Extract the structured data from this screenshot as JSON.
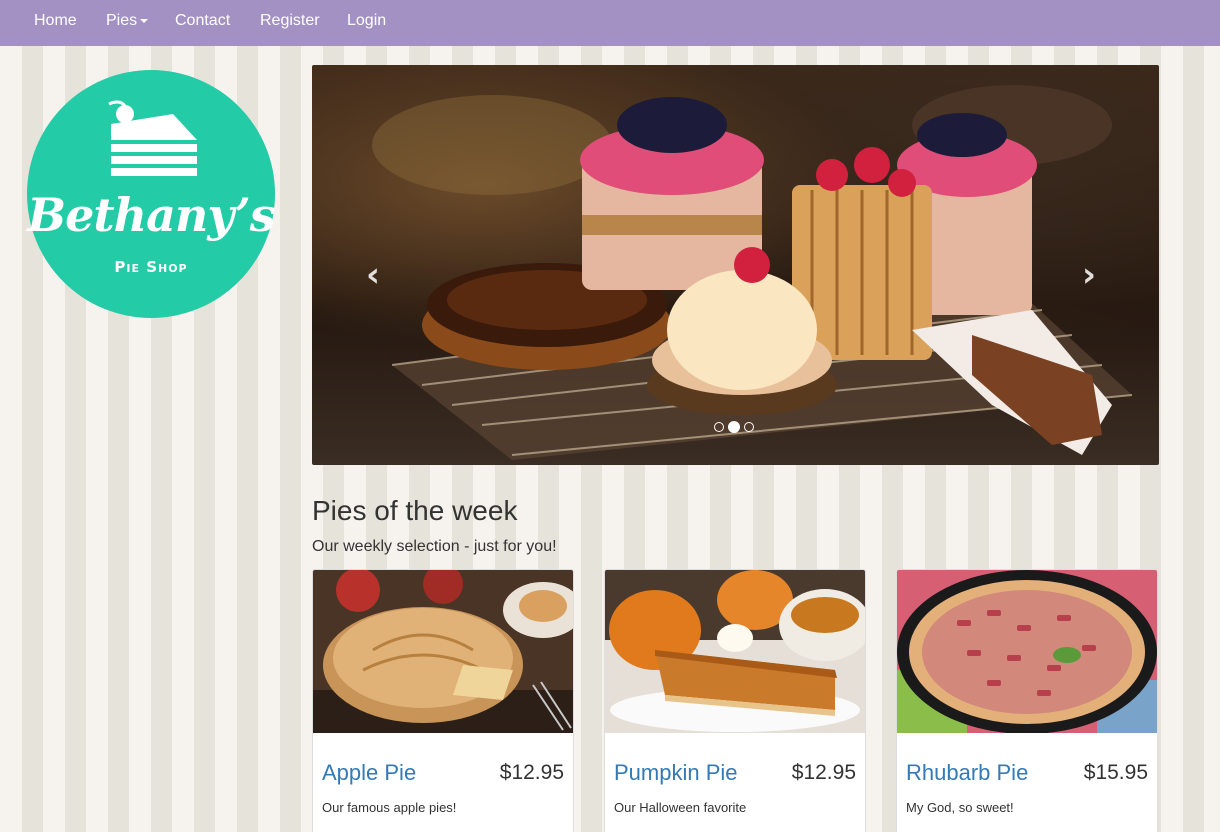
{
  "nav": {
    "items": [
      "Home",
      "Pies",
      "Contact",
      "Register",
      "Login"
    ],
    "dropdown_item": "Pies"
  },
  "logo": {
    "name": "Bethany’s",
    "subtitle": "Pie Shop",
    "color": "#23cba6"
  },
  "carousel": {
    "prev_symbol": "‹",
    "next_symbol": "›",
    "slide_count": 3,
    "active_slide": 2
  },
  "section": {
    "title": "Pies of the week",
    "subtitle": "Our weekly selection - just for you!"
  },
  "pies": [
    {
      "name": "Apple Pie",
      "price": "$12.95",
      "description": "Our famous apple pies!"
    },
    {
      "name": "Pumpkin Pie",
      "price": "$12.95",
      "description": "Our Halloween favorite"
    },
    {
      "name": "Rhubarb Pie",
      "price": "$15.95",
      "description": "My God, so sweet!"
    }
  ],
  "colors": {
    "navbar": "#a291c2",
    "link": "#337ab7",
    "stripe_light": "#f6f3ef",
    "stripe_dark": "#e6e3da"
  }
}
